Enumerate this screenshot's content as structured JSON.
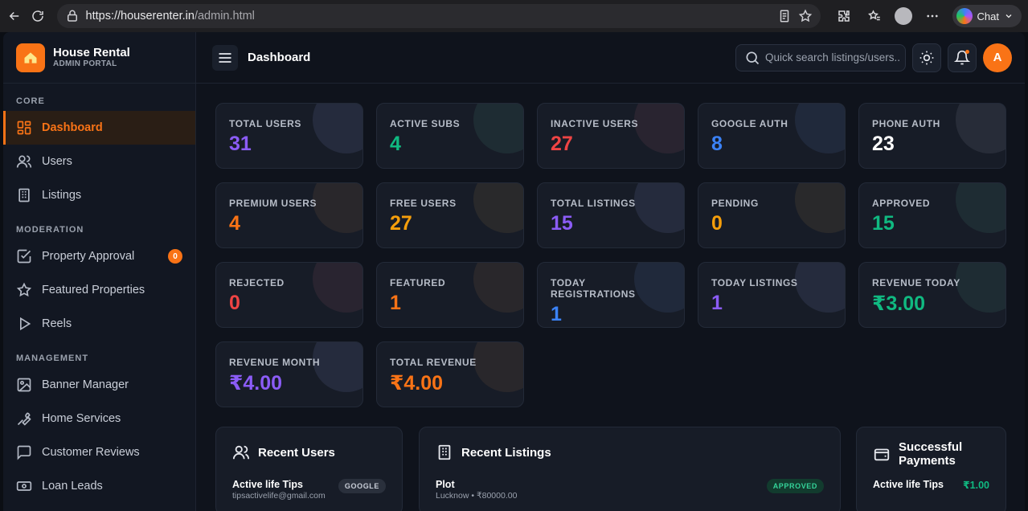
{
  "browser": {
    "url_host": "https://houserenter.in",
    "url_path": "/admin.html",
    "chat_label": "Chat"
  },
  "brand": {
    "title": "House Rental",
    "subtitle": "ADMIN PORTAL"
  },
  "sidebar": {
    "sections": [
      "CORE",
      "MODERATION",
      "MANAGEMENT"
    ],
    "items": [
      {
        "label": "Dashboard",
        "icon": "grid-icon"
      },
      {
        "label": "Users",
        "icon": "users-icon"
      },
      {
        "label": "Listings",
        "icon": "building-icon"
      },
      {
        "label": "Property Approval",
        "icon": "check-square-icon",
        "badge": "0"
      },
      {
        "label": "Featured Properties",
        "icon": "star-icon"
      },
      {
        "label": "Reels",
        "icon": "play-icon"
      },
      {
        "label": "Banner Manager",
        "icon": "image-icon"
      },
      {
        "label": "Home Services",
        "icon": "wrench-icon"
      },
      {
        "label": "Customer Reviews",
        "icon": "message-icon"
      },
      {
        "label": "Loan Leads",
        "icon": "cash-icon"
      }
    ]
  },
  "topbar": {
    "title": "Dashboard",
    "search_placeholder": "Quick search listings/users..",
    "avatar_initial": "A"
  },
  "stats": [
    {
      "label": "TOTAL USERS",
      "value": "31",
      "color": "#8b5cf6"
    },
    {
      "label": "ACTIVE SUBS",
      "value": "4",
      "color": "#10b981"
    },
    {
      "label": "INACTIVE USERS",
      "value": "27",
      "color": "#ef4444"
    },
    {
      "label": "GOOGLE AUTH",
      "value": "8",
      "color": "#3b82f6"
    },
    {
      "label": "PHONE AUTH",
      "value": "23",
      "color": "#ffffff"
    },
    {
      "label": "PREMIUM USERS",
      "value": "4",
      "color": "#f97316"
    },
    {
      "label": "FREE USERS",
      "value": "27",
      "color": "#f59e0b"
    },
    {
      "label": "TOTAL LISTINGS",
      "value": "15",
      "color": "#8b5cf6"
    },
    {
      "label": "PENDING",
      "value": "0",
      "color": "#f59e0b"
    },
    {
      "label": "APPROVED",
      "value": "15",
      "color": "#10b981"
    },
    {
      "label": "REJECTED",
      "value": "0",
      "color": "#ef4444"
    },
    {
      "label": "FEATURED",
      "value": "1",
      "color": "#f97316"
    },
    {
      "label": "TODAY REGISTRATIONS",
      "value": "1",
      "color": "#3b82f6"
    },
    {
      "label": "TODAY LISTINGS",
      "value": "1",
      "color": "#8b5cf6"
    },
    {
      "label": "REVENUE TODAY",
      "value": "₹3.00",
      "color": "#10b981"
    },
    {
      "label": "REVENUE MONTH",
      "value": "₹4.00",
      "color": "#8b5cf6"
    },
    {
      "label": "TOTAL REVENUE",
      "value": "₹4.00",
      "color": "#f97316"
    }
  ],
  "panels": {
    "recent_users": {
      "title": "Recent Users",
      "row": {
        "name": "Active life Tips",
        "email": "tipsactivelife@gmail.com",
        "tag": "GOOGLE"
      }
    },
    "recent_listings": {
      "title": "Recent Listings",
      "row": {
        "name": "Plot",
        "detail": "Lucknow • ₹80000.00",
        "tag": "APPROVED"
      }
    },
    "payments": {
      "title_line1": "Successful",
      "title_line2": "Payments",
      "row": {
        "name": "Active life Tips",
        "amount": "₹1.00"
      }
    }
  }
}
